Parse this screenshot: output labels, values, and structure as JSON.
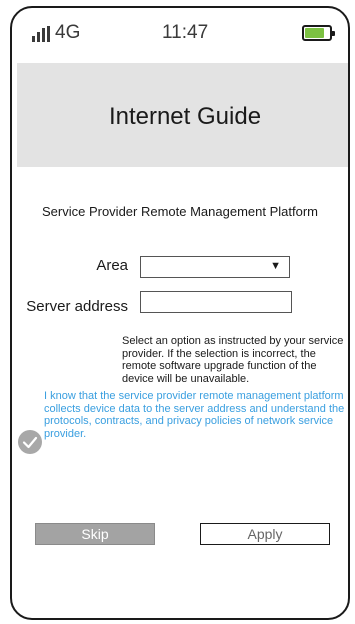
{
  "status_bar": {
    "network": "4G",
    "time": "11:47",
    "battery_level": 0.8,
    "battery_color": "#7cc142",
    "signal_icon": "signal-bars-icon",
    "battery_icon": "battery-icon"
  },
  "header": {
    "title": "Internet Guide"
  },
  "form": {
    "platform_title": "Service Provider Remote Management Platform",
    "area_label": "Area",
    "area_value": "",
    "server_label": "Server address",
    "server_value": "",
    "hint": "Select an option as instructed by your service provider. If the selection is incorrect, the remote software upgrade function of the device will be unavailable."
  },
  "agreement": {
    "text": "I know that the service provider remote management platform collects device data to the server address and understand the protocols, contracts, and privacy policies of network service provider.",
    "checked": true,
    "link_color": "#3a9fe0",
    "check_icon": "checkmark-icon"
  },
  "buttons": {
    "skip_label": "Skip",
    "apply_label": "Apply"
  }
}
